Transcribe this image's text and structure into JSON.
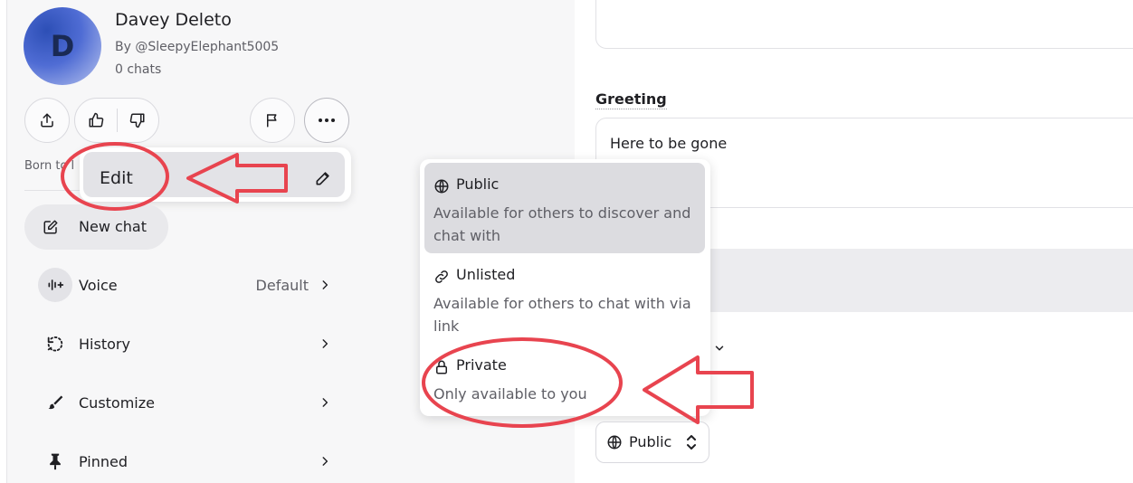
{
  "character": {
    "avatar_letter": "D",
    "name": "Davey Deleto",
    "by": "By @SleepyElephant5005",
    "chats": "0 chats",
    "description": "Born to l"
  },
  "edit_menu": {
    "edit_label": "Edit"
  },
  "new_chat_label": "New chat",
  "menu": {
    "voice_label": "Voice",
    "voice_value": "Default",
    "history_label": "History",
    "customize_label": "Customize",
    "pinned_label": "Pinned"
  },
  "greeting": {
    "label": "Greeting",
    "text": "Here to be gone"
  },
  "visibility": {
    "options": [
      {
        "title": "Public",
        "desc": "Available for others to discover and chat with"
      },
      {
        "title": "Unlisted",
        "desc": "Available for others to chat with via link"
      },
      {
        "title": "Private",
        "desc": "Only available to you"
      }
    ],
    "selected_label": "Public"
  },
  "colors": {
    "annotation_red": "#e8444f",
    "selected_bg": "#dcdce0",
    "panel_bg": "#f7f7f8"
  }
}
